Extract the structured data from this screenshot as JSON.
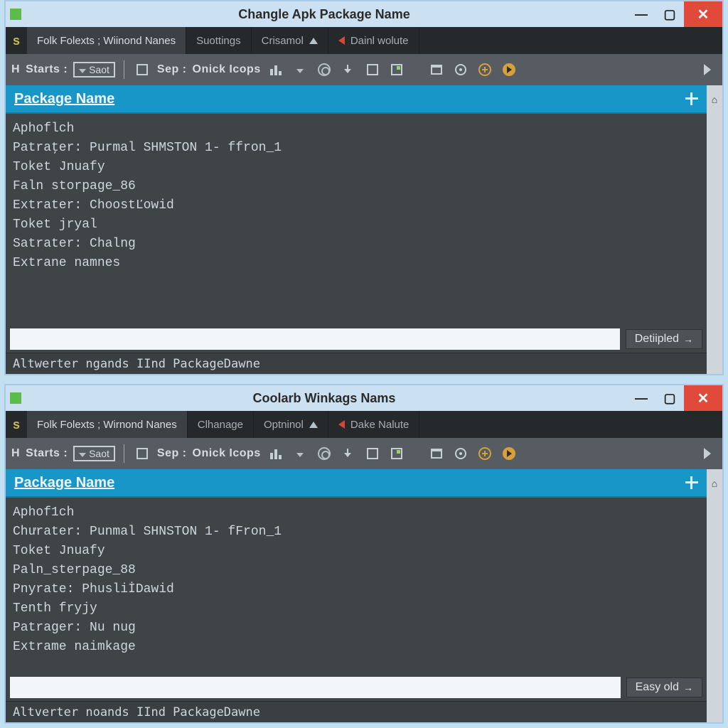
{
  "windows": [
    {
      "title": "Changle Apk Package Name",
      "tabs": [
        {
          "label": "Folk Folexts ; Wiinond Nanes",
          "active": true
        },
        {
          "label": "Suottings"
        },
        {
          "label": "Crisamol",
          "tri": true
        },
        {
          "label": "Dainl wolute",
          "red": true
        }
      ],
      "toolbar": {
        "starts_lbl": "Starts :",
        "saot_lbl": "Saot",
        "sep_lbl": "Sep  :",
        "onick_lbl": "Onick Icops"
      },
      "panel_title": "Package Name",
      "code_lines": [
        "Aphoflch",
        "Patraţer: Purmal SHMSTON 1- ffron_1",
        "Toket Jnuafy",
        "Faln storpage_86",
        "Extrater: ChoostĽowid",
        "Toket jryal",
        "Satrater: Chalng",
        "Extrane namnes"
      ],
      "action_btn": "Detiipled",
      "status": "Altwerter ngands IInd PackageDawne"
    },
    {
      "title": "Coolarb Winkags Nams",
      "tabs": [
        {
          "label": "Folk Folexts ; Wirnond Nanes",
          "active": true
        },
        {
          "label": "Clhanage"
        },
        {
          "label": "Optninol",
          "tri": true
        },
        {
          "label": "Dake Nalute",
          "red": true
        }
      ],
      "toolbar": {
        "starts_lbl": "Starts :",
        "saot_lbl": "Saot",
        "sep_lbl": "Sep  :",
        "onick_lbl": "Onick Icops"
      },
      "panel_title": "Package Name",
      "code_lines": [
        "Aphof1ch",
        "Chưrater: Punmal SHNSTON 1- fFron_1",
        "Toket Jnuafy",
        "Paln_sterpage_88",
        "Pnyrate: PhusliİDawid",
        "Tenth fryjy",
        "Patrager: Nu nug",
        "Extrame naimkage"
      ],
      "action_btn": "Easy old",
      "status": "Altverter noands IInd PackageDawne"
    }
  ]
}
